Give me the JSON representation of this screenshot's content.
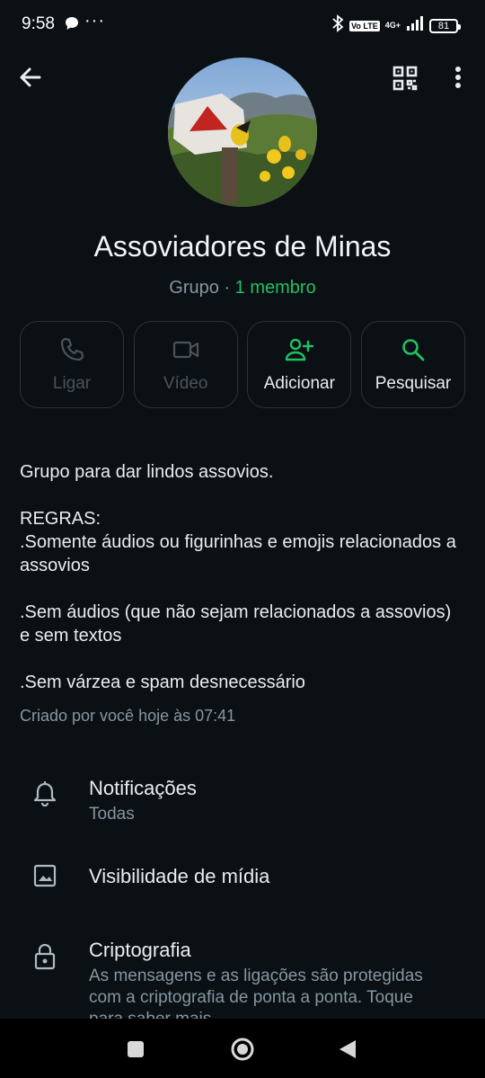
{
  "status_bar": {
    "time": "9:58",
    "more": "···",
    "volte": "Vo LTE",
    "network": "4G+",
    "battery": "81",
    "icons": [
      "chat-bubble-icon",
      "bluetooth-icon",
      "signal-icon",
      "battery-icon"
    ]
  },
  "header": {
    "back_icon": "arrow-left-icon",
    "qr_icon": "qr-code-icon",
    "menu_icon": "more-vertical-icon"
  },
  "group": {
    "name": "Assoviadores de Minas",
    "type_label": "Grupo",
    "separator": " · ",
    "members": "1 membro"
  },
  "actions": [
    {
      "label": "Ligar",
      "icon": "phone-icon",
      "enabled": false
    },
    {
      "label": "Vídeo",
      "icon": "video-icon",
      "enabled": false
    },
    {
      "label": "Adicionar",
      "icon": "add-person-icon",
      "enabled": true
    },
    {
      "label": "Pesquisar",
      "icon": "search-icon",
      "enabled": true
    }
  ],
  "description": "Grupo para dar lindos assovios.\n\nREGRAS:\n.Somente áudios ou figurinhas e emojis relacionados a assovios\n\n.Sem áudios (que não sejam relacionados a assovios) e sem textos\n\n.Sem várzea e spam desnecessário",
  "created": "Criado por você hoje às 07:41",
  "settings": {
    "notifications": {
      "title": "Notificações",
      "subtitle": "Todas",
      "icon": "bell-icon"
    },
    "media": {
      "title": "Visibilidade de mídia",
      "icon": "image-icon"
    },
    "encryption": {
      "title": "Criptografia",
      "subtitle": "As mensagens e as ligações são protegidas com a criptografia de ponta a ponta. Toque para saber mais.",
      "icon": "lock-icon"
    }
  },
  "colors": {
    "background": "#0b1014",
    "accent": "#21c063",
    "text": "#e9edef",
    "muted": "#8696a0"
  }
}
